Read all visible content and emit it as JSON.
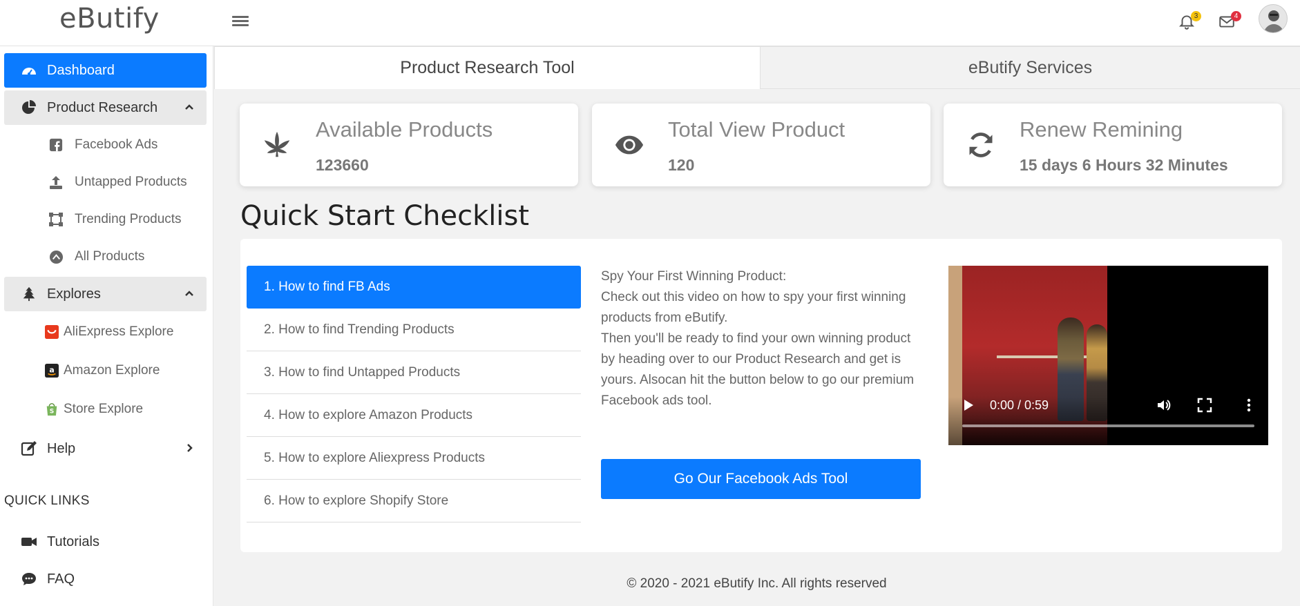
{
  "header": {
    "brand": "eButify",
    "notifications_count": "3",
    "messages_count": "4"
  },
  "sidebar": {
    "dashboard": "Dashboard",
    "product_research": "Product Research",
    "product_research_items": [
      "Facebook Ads",
      "Untapped Products",
      "Trending Products",
      "All Products"
    ],
    "explores": "Explores",
    "explores_items": [
      "AliExpress Explore",
      "Amazon Explore",
      "Store Explore"
    ],
    "help": "Help",
    "quick_links_title": "QUICK LINKS",
    "quick_links": [
      "Tutorials",
      "FAQ"
    ]
  },
  "tabs": [
    "Product Research Tool",
    "eButify Services"
  ],
  "stats": [
    {
      "title": "Available Products",
      "value": "123660",
      "icon": "cannabis-leaf-icon"
    },
    {
      "title": "Total View Product",
      "value": "120",
      "icon": "eye-icon"
    },
    {
      "title": "Renew Remining",
      "value": "15 days 6 Hours 32 Minutes",
      "icon": "refresh-icon"
    }
  ],
  "checklist": {
    "title": "Quick Start Checklist",
    "items": [
      "1. How to find FB Ads",
      "2. How to find Trending Products",
      "3. How to find Untapped Products",
      "4. How to explore Amazon Products",
      "5. How to explore Aliexpress Products",
      "6. How to explore Shopify Store"
    ],
    "active_index": 0,
    "description_lines": [
      "Spy Your First Winning Product:",
      "Check out this video on how to spy your first winning products from eButify.",
      "Then you'll be ready to find your own winning product by heading over to our Product Research and get is yours. Alsocan hit the button below to go our premium Facebook ads tool."
    ],
    "cta_label": "Go Our Facebook Ads Tool"
  },
  "video": {
    "time": "0:00 / 0:59",
    "progress": 0
  },
  "footer": "© 2020 - 2021 eButify Inc. All rights reserved",
  "colors": {
    "accent": "#0b7bff",
    "group_bg": "#e9e9e9",
    "badge_yellow": "#f4c20d",
    "badge_red": "#e03040"
  }
}
